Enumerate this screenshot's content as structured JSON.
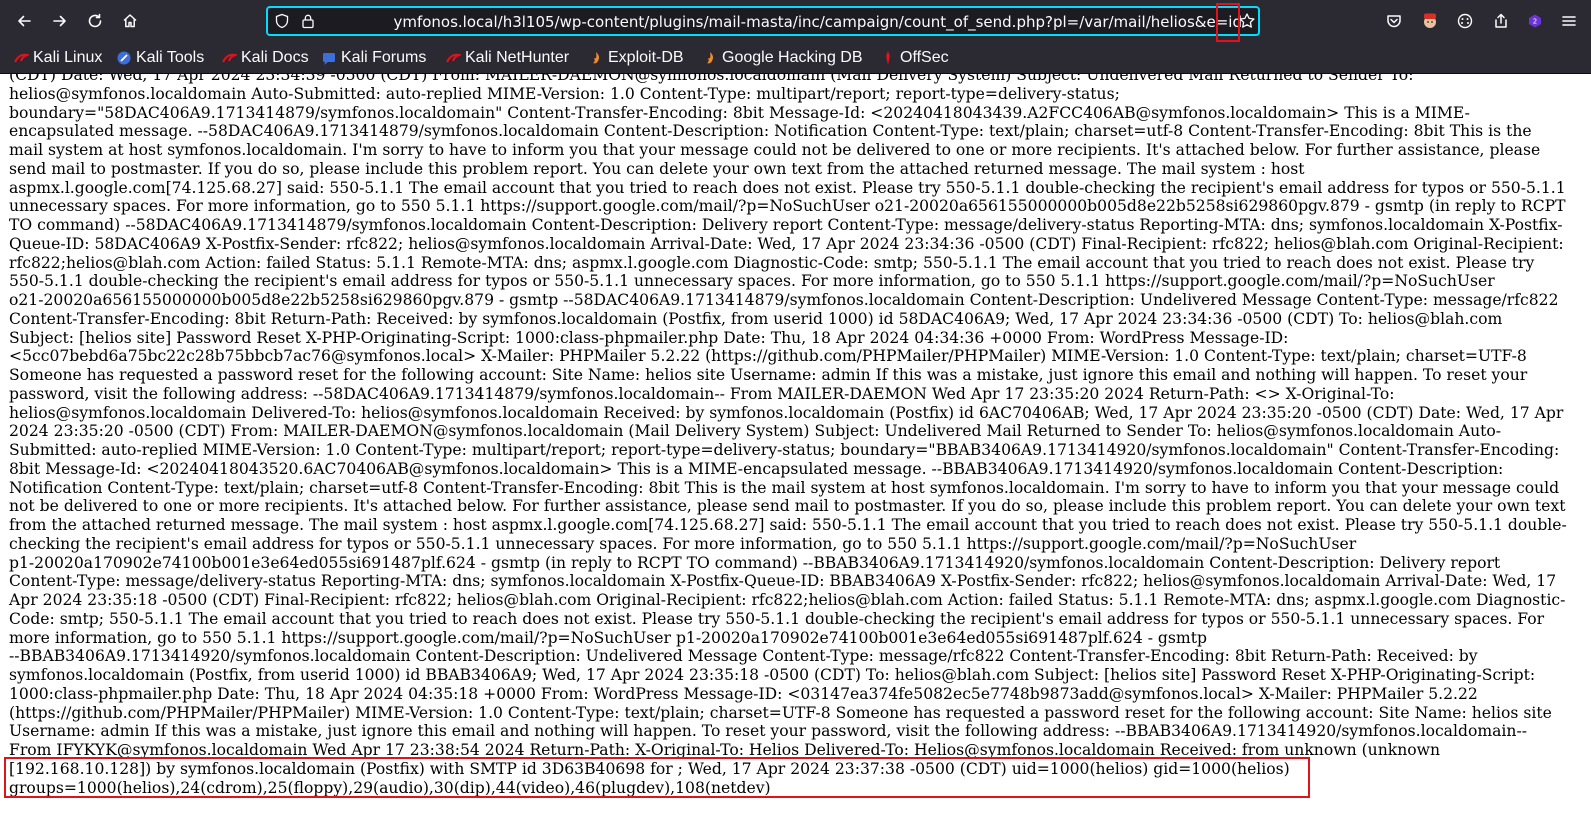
{
  "browser": {
    "url": "ymfonos.local/h3l105/wp-content/plugins/mail-masta/inc/campaign/count_of_send.php?pl=/var/mail/helios&e=id",
    "accent": "#00ddff",
    "highlight_color": "#e0121b",
    "nav_icons": [
      "back-arrow-icon",
      "forward-arrow-icon",
      "reload-icon",
      "home-icon"
    ],
    "toolbar_icons": [
      "pocket-icon",
      "profile-icon",
      "extensions-icon",
      "share-icon",
      "hackbar-icon",
      "menu-icon"
    ]
  },
  "bookmarks": [
    {
      "label": "Kali Linux",
      "icon": "kali-dragon-icon"
    },
    {
      "label": "Kali Tools",
      "icon": "kali-tools-icon"
    },
    {
      "label": "Kali Docs",
      "icon": "kali-dragon-icon"
    },
    {
      "label": "Kali Forums",
      "icon": "kali-forums-icon"
    },
    {
      "label": "Kali NetHunter",
      "icon": "kali-dragon-icon"
    },
    {
      "label": "Exploit-DB",
      "icon": "exploit-db-icon"
    },
    {
      "label": "Google Hacking DB",
      "icon": "exploit-db-icon"
    },
    {
      "label": "OffSec",
      "icon": "offsec-icon"
    }
  ],
  "page": {
    "lines": [
      "(CDT) Date: Wed, 17 Apr 2024 23:34:39 -0500 (CDT) From: MAILER-DAEMON@symfonos.localdomain (Mail Delivery System) Subject: Undelivered Mail Returned to Sender To:",
      "helios@symfonos.localdomain Auto-Submitted: auto-replied MIME-Version: 1.0 Content-Type: multipart/report; report-type=delivery-status;",
      "boundary=\"58DAC406A9.1713414879/symfonos.localdomain\" Content-Transfer-Encoding: 8bit Message-Id: <20240418043439.A2FCC406AB@symfonos.localdomain> This is a MIME-",
      "encapsulated message. --58DAC406A9.1713414879/symfonos.localdomain Content-Description: Notification Content-Type: text/plain; charset=utf-8 Content-Transfer-Encoding: 8bit This is the",
      "mail system at host symfonos.localdomain. I'm sorry to have to inform you that your message could not be delivered to one or more recipients. It's attached below. For further assistance, please",
      "send mail to postmaster. If you do so, please include this problem report. You can delete your own text from the attached returned message. The mail system : host",
      "aspmx.l.google.com[74.125.68.27] said: 550-5.1.1 The email account that you tried to reach does not exist. Please try 550-5.1.1 double-checking the recipient's email address for typos or 550-5.1.1",
      "unnecessary spaces. For more information, go to 550 5.1.1 https://support.google.com/mail/?p=NoSuchUser o21-20020a656155000000b005d8e22b5258si629860pgv.879 - gsmtp (in reply to RCPT",
      "TO command) --58DAC406A9.1713414879/symfonos.localdomain Content-Description: Delivery report Content-Type: message/delivery-status Reporting-MTA: dns; symfonos.localdomain X-Postfix-",
      "Queue-ID: 58DAC406A9 X-Postfix-Sender: rfc822; helios@symfonos.localdomain Arrival-Date: Wed, 17 Apr 2024 23:34:36 -0500 (CDT) Final-Recipient: rfc822; helios@blah.com Original-Recipient:",
      "rfc822;helios@blah.com Action: failed Status: 5.1.1 Remote-MTA: dns; aspmx.l.google.com Diagnostic-Code: smtp; 550-5.1.1 The email account that you tried to reach does not exist. Please try",
      "550-5.1.1 double-checking the recipient's email address for typos or 550-5.1.1 unnecessary spaces. For more information, go to 550 5.1.1 https://support.google.com/mail/?p=NoSuchUser",
      "o21-20020a656155000000b005d8e22b5258si629860pgv.879 - gsmtp --58DAC406A9.1713414879/symfonos.localdomain Content-Description: Undelivered Message Content-Type: message/rfc822",
      "Content-Transfer-Encoding: 8bit Return-Path: Received: by symfonos.localdomain (Postfix, from userid 1000) id 58DAC406A9; Wed, 17 Apr 2024 23:34:36 -0500 (CDT) To: helios@blah.com",
      "Subject: [helios site] Password Reset X-PHP-Originating-Script: 1000:class-phpmailer.php Date: Thu, 18 Apr 2024 04:34:36 +0000 From: WordPress Message-ID:",
      "<5cc07bebd6a75bc22c28b75bbcb7ac76@symfonos.local> X-Mailer: PHPMailer 5.2.22 (https://github.com/PHPMailer/PHPMailer) MIME-Version: 1.0 Content-Type: text/plain; charset=UTF-8",
      "Someone has requested a password reset for the following account: Site Name: helios site Username: admin If this was a mistake, just ignore this email and nothing will happen. To reset your",
      "password, visit the following address: --58DAC406A9.1713414879/symfonos.localdomain-- From MAILER-DAEMON Wed Apr 17 23:35:20 2024 Return-Path: <> X-Original-To:",
      "helios@symfonos.localdomain Delivered-To: helios@symfonos.localdomain Received: by symfonos.localdomain (Postfix) id 6AC70406AB; Wed, 17 Apr 2024 23:35:20 -0500 (CDT) Date: Wed, 17 Apr",
      "2024 23:35:20 -0500 (CDT) From: MAILER-DAEMON@symfonos.localdomain (Mail Delivery System) Subject: Undelivered Mail Returned to Sender To: helios@symfonos.localdomain Auto-",
      "Submitted: auto-replied MIME-Version: 1.0 Content-Type: multipart/report; report-type=delivery-status; boundary=\"BBAB3406A9.1713414920/symfonos.localdomain\" Content-Transfer-Encoding:",
      "8bit Message-Id: <20240418043520.6AC70406AB@symfonos.localdomain> This is a MIME-encapsulated message. --BBAB3406A9.1713414920/symfonos.localdomain Content-Description:",
      "Notification Content-Type: text/plain; charset=utf-8 Content-Transfer-Encoding: 8bit This is the mail system at host symfonos.localdomain. I'm sorry to have to inform you that your message could",
      "not be delivered to one or more recipients. It's attached below. For further assistance, please send mail to postmaster. If you do so, please include this problem report. You can delete your own text",
      "from the attached returned message. The mail system : host aspmx.l.google.com[74.125.68.27] said: 550-5.1.1 The email account that you tried to reach does not exist. Please try 550-5.1.1 double-",
      "checking the recipient's email address for typos or 550-5.1.1 unnecessary spaces. For more information, go to 550 5.1.1 https://support.google.com/mail/?p=NoSuchUser",
      "p1-20020a170902e74100b001e3e64ed055si691487plf.624 - gsmtp (in reply to RCPT TO command) --BBAB3406A9.1713414920/symfonos.localdomain Content-Description: Delivery report",
      "Content-Type: message/delivery-status Reporting-MTA: dns; symfonos.localdomain X-Postfix-Queue-ID: BBAB3406A9 X-Postfix-Sender: rfc822; helios@symfonos.localdomain Arrival-Date: Wed, 17",
      "Apr 2024 23:35:18 -0500 (CDT) Final-Recipient: rfc822; helios@blah.com Original-Recipient: rfc822;helios@blah.com Action: failed Status: 5.1.1 Remote-MTA: dns; aspmx.l.google.com Diagnostic-",
      "Code: smtp; 550-5.1.1 The email account that you tried to reach does not exist. Please try 550-5.1.1 double-checking the recipient's email address for typos or 550-5.1.1 unnecessary spaces. For",
      "more information, go to 550 5.1.1 https://support.google.com/mail/?p=NoSuchUser p1-20020a170902e74100b001e3e64ed055si691487plf.624 - gsmtp",
      "--BBAB3406A9.1713414920/symfonos.localdomain Content-Description: Undelivered Message Content-Type: message/rfc822 Content-Transfer-Encoding: 8bit Return-Path: Received: by",
      "symfonos.localdomain (Postfix, from userid 1000) id BBAB3406A9; Wed, 17 Apr 2024 23:35:18 -0500 (CDT) To: helios@blah.com Subject: [helios site] Password Reset X-PHP-Originating-Script:",
      "1000:class-phpmailer.php Date: Thu, 18 Apr 2024 04:35:18 +0000 From: WordPress Message-ID: <03147ea374fe5082ec5e7748b9873add@symfonos.local> X-Mailer: PHPMailer 5.2.22",
      "(https://github.com/PHPMailer/PHPMailer) MIME-Version: 1.0 Content-Type: text/plain; charset=UTF-8 Someone has requested a password reset for the following account: Site Name: helios site",
      "Username: admin If this was a mistake, just ignore this email and nothing will happen. To reset your password, visit the following address: --BBAB3406A9.1713414920/symfonos.localdomain--",
      "From IFYKYK@symfonos.localdomain Wed Apr 17 23:38:54 2024 Return-Path: X-Original-To: Helios Delivered-To: Helios@symfonos.localdomain Received: from unknown (unknown",
      "[192.168.10.128]) by symfonos.localdomain (Postfix) with SMTP id 3D63B40698 for ; Wed, 17 Apr 2024 23:37:38 -0500 (CDT) uid=1000(helios) gid=1000(helios)",
      "groups=1000(helios),24(cdrom),25(floppy),29(audio),30(dip),44(video),46(plugdev),108(netdev)"
    ]
  }
}
